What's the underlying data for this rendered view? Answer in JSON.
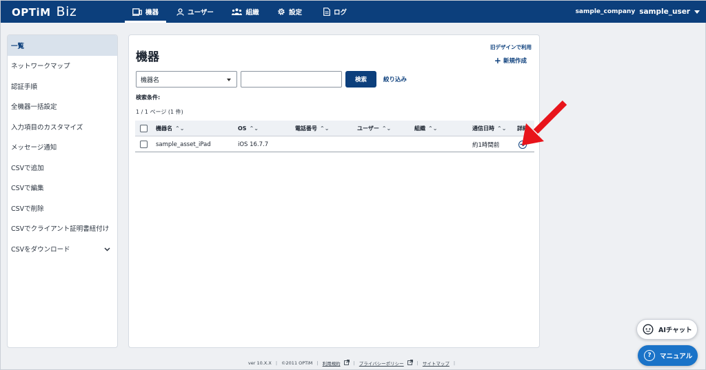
{
  "brand": {
    "name": "OPTiM",
    "product": "Biz"
  },
  "nav": [
    {
      "label": "機器",
      "icon": "device-icon",
      "active": true
    },
    {
      "label": "ユーザー",
      "icon": "user-icon",
      "active": false
    },
    {
      "label": "組織",
      "icon": "organization-icon",
      "active": false
    },
    {
      "label": "設定",
      "icon": "gear-icon",
      "active": false
    },
    {
      "label": "ログ",
      "icon": "log-icon",
      "active": false
    }
  ],
  "account": {
    "company": "sample_company",
    "user": "sample_user"
  },
  "sidebar": {
    "items": [
      {
        "label": "一覧",
        "active": true
      },
      {
        "label": "ネットワークマップ"
      },
      {
        "label": "認証手順"
      },
      {
        "label": "全機器一括設定"
      },
      {
        "label": "入力項目のカスタマイズ"
      },
      {
        "label": "メッセージ通知"
      },
      {
        "label": "CSVで追加"
      },
      {
        "label": "CSVで編集"
      },
      {
        "label": "CSVで削除"
      },
      {
        "label": "CSVでクライアント証明書紐付け"
      },
      {
        "label": "CSVをダウンロード"
      }
    ]
  },
  "main": {
    "title": "機器",
    "old_design_link": "旧デザインで利用",
    "new_button": "新規作成",
    "search": {
      "field_select": "機器名",
      "keyword_value": "",
      "search_button": "検索",
      "filter_link": "絞り込み"
    },
    "conditions_label": "検索条件:",
    "page_count": "1 / 1 ページ (1 件)",
    "table": {
      "columns": [
        "機器名",
        "OS",
        "電話番号",
        "ユーザー",
        "組織",
        "通信日時",
        "詳細"
      ],
      "rows": [
        {
          "name": "sample_asset_iPad",
          "os": "iOS 16.7.7",
          "phone": "",
          "user": "",
          "org": "",
          "last_comm": "約1時間前"
        }
      ]
    }
  },
  "footer": {
    "version": "ver 10.X.X",
    "copyright": "©2011 OPTiM",
    "links": [
      "利用規約",
      "プライバシーポリシー",
      "サイトマップ"
    ]
  },
  "floating": {
    "ai_chat": "AIチャット",
    "manual": "マニュアル"
  },
  "colors": {
    "primary": "#0c3f7c",
    "annotation_arrow": "#e8141b",
    "manual_button": "#1a73c8"
  }
}
